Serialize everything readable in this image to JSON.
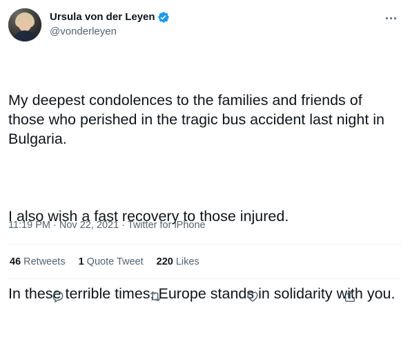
{
  "author": {
    "display_name": "Ursula von der Leyen",
    "handle": "@vonderleyen",
    "verified": true
  },
  "tweet": {
    "paragraphs": [
      "My deepest condolences to the families and friends of those who perished in the tragic bus accident last night in Bulgaria.",
      "I also wish a fast recovery to those injured.",
      "In these terrible times, Europe stands in solidarity with you."
    ],
    "time": "11:19 PM",
    "separator": " · ",
    "date": "Nov 22, 2021",
    "source": "Twitter for iPhone"
  },
  "stats": {
    "retweets_count": "46",
    "retweets_label": "Retweets",
    "quotes_count": "1",
    "quotes_label": "Quote Tweet",
    "likes_count": "220",
    "likes_label": "Likes"
  },
  "icons": {
    "more": "more-horizontal-icon",
    "reply": "reply-icon",
    "retweet": "retweet-icon",
    "like": "heart-icon",
    "share": "share-icon",
    "verified": "verified-badge-icon"
  },
  "colors": {
    "text_primary": "#0f1419",
    "text_secondary": "#536471",
    "verified_blue": "#1d9bf0",
    "divider": "#eff3f4"
  }
}
